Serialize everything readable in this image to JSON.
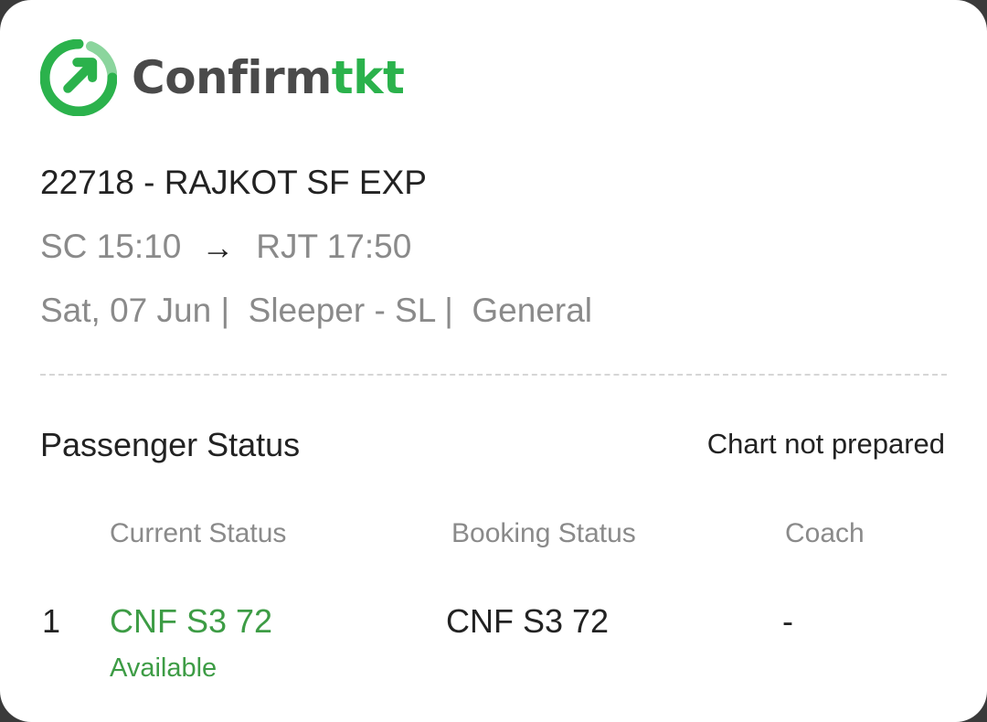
{
  "brand": {
    "name_part1": "Confirm",
    "name_part2": "tkt",
    "logo_icon": "confirmtkt-logo-icon",
    "colors": {
      "green": "#2bb24c",
      "dark": "#4a4a4a"
    }
  },
  "train": {
    "title": "22718 - RAJKOT SF EXP",
    "from": "SC 15:10",
    "arrow": "→",
    "to": "RJT 17:50",
    "meta": "Sat, 07 Jun |  Sleeper - SL |  General"
  },
  "passenger_status": {
    "title": "Passenger Status",
    "chart_status": "Chart not prepared",
    "columns": [
      "Current Status",
      "Booking Status",
      "Coach"
    ],
    "rows": [
      {
        "index": "1",
        "current_status": "CNF S3 72",
        "availability": "Available",
        "booking_status": "CNF S3 72",
        "coach": "-"
      }
    ],
    "colors": {
      "confirmed": "#3d9c45"
    }
  }
}
